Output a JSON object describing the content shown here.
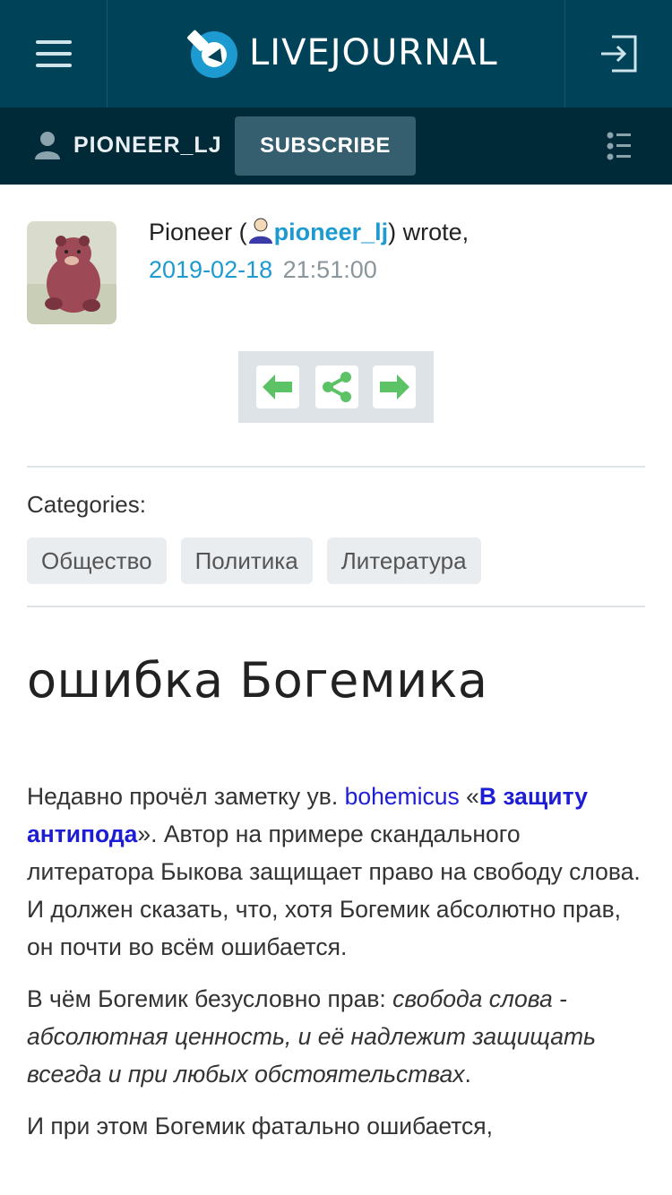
{
  "header": {
    "logo_text": "LIVEJOURNAL",
    "brand_color": "#1d9bd1",
    "background": "#004359"
  },
  "journal_bar": {
    "username": "PIONEER_LJ",
    "subscribe_label": "SUBSCRIBE",
    "background": "#012a39"
  },
  "entry": {
    "author_name": "Pioneer",
    "author_open": " (",
    "author_lj": "pioneer_lj",
    "author_close": ") wrote,",
    "date": "2019-02-18",
    "time": "21:51:00"
  },
  "categories": {
    "label": "Categories:",
    "items": [
      "Общество",
      "Политика",
      "Литература"
    ]
  },
  "post": {
    "title": "ошибка Богемика",
    "p1_a": "Недавно прочёл заметку ув. ",
    "p1_link_user": "bohemicus",
    "p1_quote_open": " «",
    "p1_link_title": "В защиту антипода",
    "p1_b": "». Автор на примере скандального литератора Быкова защищает право на свободу слова. И должен сказать, что, хотя Богемик абсолютно прав, он почти во всём ошибается.",
    "p2_a": "В чём Богемик безусловно прав: ",
    "p2_em": "свобода слова - абсолютная ценность, и её надлежит защищать всегда и при любых обстоятельствах",
    "p2_b": ".",
    "p3": "И при этом Богемик фатально ошибается,"
  },
  "icons": {
    "menu": "hamburger-icon",
    "login": "login-icon",
    "user": "user-icon",
    "toc": "list-icon",
    "prev": "arrow-left-icon",
    "share": "share-icon",
    "next": "arrow-right-icon"
  }
}
